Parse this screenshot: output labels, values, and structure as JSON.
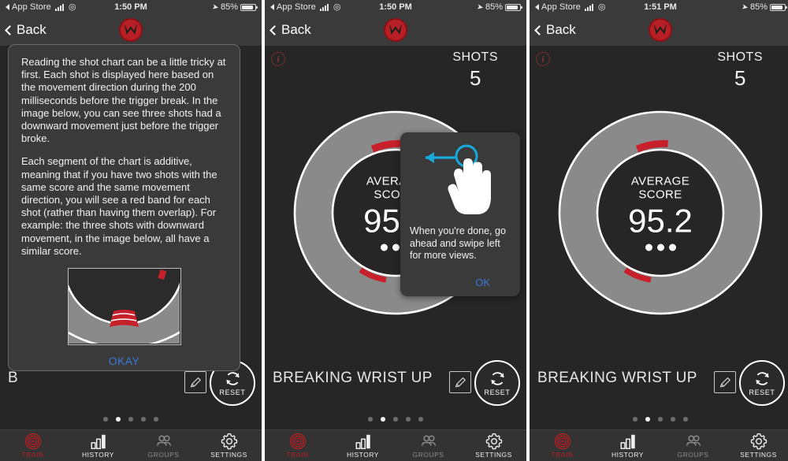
{
  "theme": {
    "bg": "#262626",
    "bar_bg": "#3a3a3a",
    "accent_red": "#b81f24",
    "gauge_gray": "#8a8a8a",
    "link_blue": "#3c78d8",
    "arc_red": "#c8202a"
  },
  "panels": [
    {
      "id": "panel-help-dialog",
      "statusbar": {
        "back_app": "App Store",
        "time": "1:50 PM",
        "battery": "85%",
        "signal_icon": "signal-bars-icon",
        "wifi_icon": "wifi-icon",
        "location_icon": "location-arrow-icon",
        "battery_icon": "battery-icon"
      },
      "nav": {
        "back_label": "Back",
        "logo_icon": "mantis-logo-icon"
      },
      "dialog": {
        "paragraph1": "Reading the shot chart can be a little tricky at first. Each shot is displayed here based on the movement direction during the 200 milliseconds before the trigger break. In the image below, you can see three shots had a downward movement just before the trigger broke.",
        "paragraph2": "Each segment of the chart is additive, meaning that if you have two shots with the same score and the same movement direction, you will see a red band for each shot (rather than having them overlap). For example: the three shots with downward movement, in the image below, all have a similar score.",
        "thumbnail_name": "shot-chart-example-image",
        "okay_label": "OKAY"
      },
      "behind_label": "B",
      "reset_label": "RESET",
      "page_dots": {
        "count": 5,
        "active_index": 1
      }
    },
    {
      "id": "panel-swipe-tooltip",
      "statusbar": {
        "back_app": "App Store",
        "time": "1:50 PM",
        "battery": "85%",
        "signal_icon": "signal-bars-icon",
        "wifi_icon": "wifi-icon",
        "location_icon": "location-arrow-icon",
        "battery_icon": "battery-icon"
      },
      "nav": {
        "back_label": "Back",
        "logo_icon": "mantis-logo-icon"
      },
      "info_icon": "info-circle-icon",
      "shots": {
        "label": "SHOTS",
        "value": "5"
      },
      "gauge": {
        "label_line1": "AVERAGE",
        "label_line2": "SCORE",
        "value": "95.2",
        "dots": 3
      },
      "metric_label": "BREAKING WRIST UP",
      "reset_label": "RESET",
      "edit_icon": "pencil-icon",
      "page_dots": {
        "count": 5,
        "active_index": 1
      },
      "tooltip": {
        "hand_icon": "swipe-left-hand-icon",
        "text": "When you're done, go ahead and swipe left for more views.",
        "ok_label": "OK"
      }
    },
    {
      "id": "panel-gauge",
      "statusbar": {
        "back_app": "App Store",
        "time": "1:51 PM",
        "battery": "85%",
        "signal_icon": "signal-bars-icon",
        "wifi_icon": "wifi-icon",
        "location_icon": "location-arrow-icon",
        "battery_icon": "battery-icon"
      },
      "nav": {
        "back_label": "Back",
        "logo_icon": "mantis-logo-icon"
      },
      "info_icon": "info-circle-icon",
      "shots": {
        "label": "SHOTS",
        "value": "5"
      },
      "gauge": {
        "label_line1": "AVERAGE",
        "label_line2": "SCORE",
        "value": "95.2",
        "dots": 3
      },
      "metric_label": "BREAKING WRIST UP",
      "reset_label": "RESET",
      "edit_icon": "pencil-icon",
      "page_dots": {
        "count": 5,
        "active_index": 1
      }
    }
  ],
  "tabbar": {
    "items": [
      {
        "label": "TRAIN",
        "icon": "target-icon",
        "active": true
      },
      {
        "label": "HISTORY",
        "icon": "bar-chart-icon",
        "active": false
      },
      {
        "label": "GROUPS",
        "icon": "people-icon",
        "active": false
      },
      {
        "label": "SETTINGS",
        "icon": "gear-icon",
        "active": false
      }
    ]
  }
}
